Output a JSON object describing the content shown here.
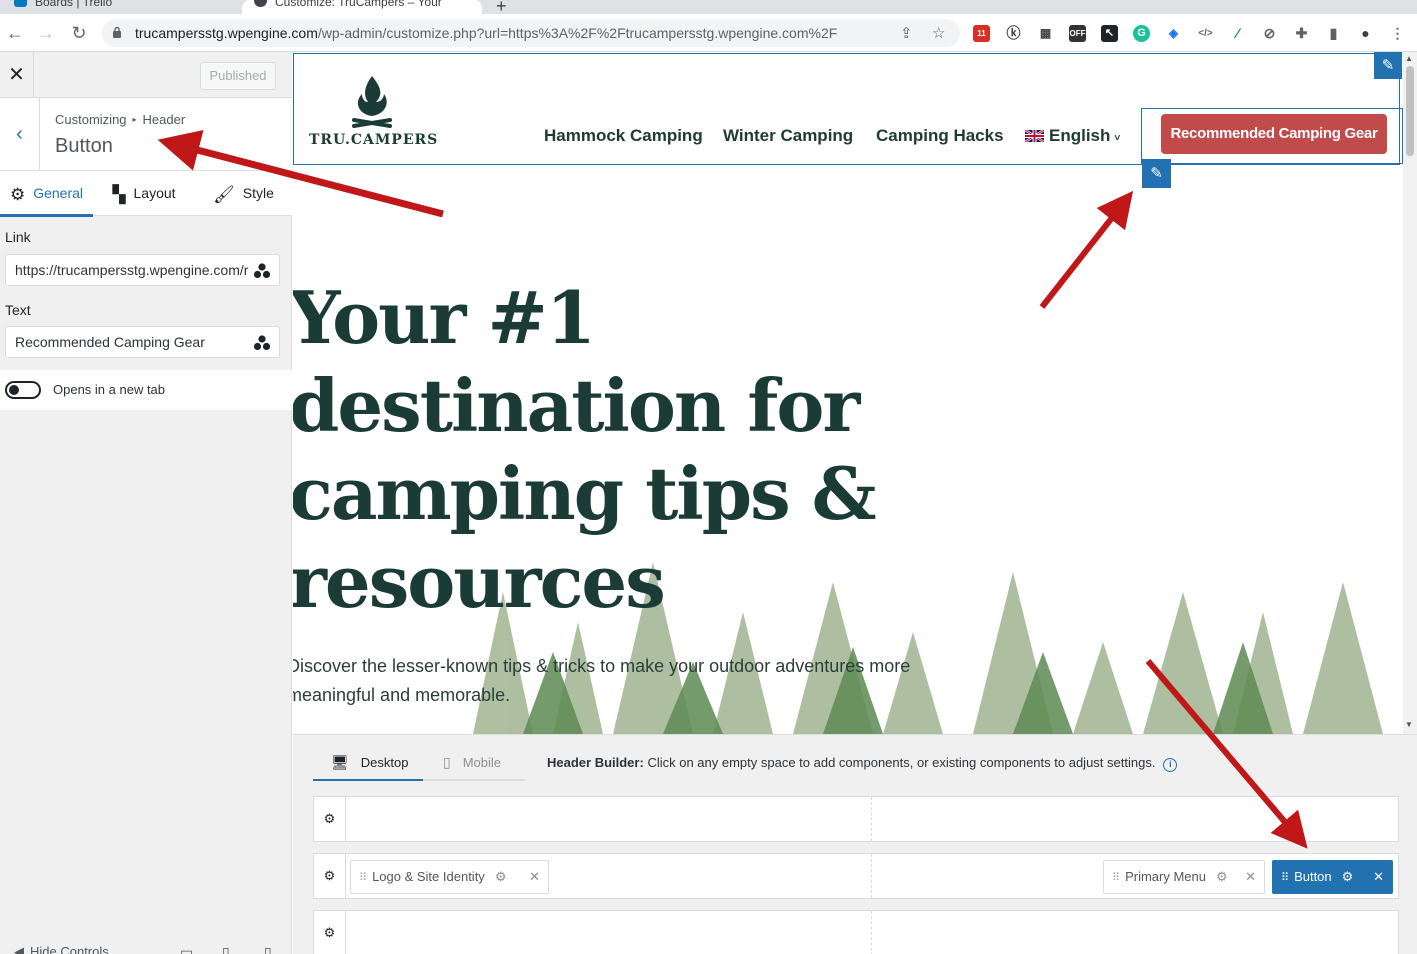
{
  "browser": {
    "tabs": [
      {
        "title": "Boards | Trello"
      },
      {
        "title": "Customize: TruCampers – Your"
      }
    ],
    "url_host": "trucampersstg.wpengine.com",
    "url_path": "/wp-admin/customize.php?url=https%3A%2F%2Ftrucampersstg.wpengine.com%2F",
    "calendar_badge": "11",
    "ext_off_label": "OFF"
  },
  "sidebar": {
    "published_label": "Published",
    "breadcrumb": {
      "root": "Customizing",
      "parent": "Header"
    },
    "section_title": "Button",
    "tabs": [
      {
        "label": "General",
        "active": true
      },
      {
        "label": "Layout",
        "active": false
      },
      {
        "label": "Style",
        "active": false
      }
    ],
    "link_label": "Link",
    "link_value": "https://trucampersstg.wpengine.com/r",
    "text_label": "Text",
    "text_value": "Recommended Camping Gear",
    "new_tab_label": "Opens in a new tab",
    "new_tab_enabled": false,
    "hide_controls_label": "Hide Controls"
  },
  "preview": {
    "logo_text": "TRU.CAMPERS",
    "menu": [
      "Hammock Camping",
      "Winter Camping",
      "Camping Hacks",
      "English"
    ],
    "cta_label": "Recommended Camping Gear",
    "cta_color": "#c14a4a",
    "hero_title": "Your #1 destination for camping tips & resources",
    "hero_subtitle": "Discover the lesser-known tips & tricks to make your outdoor adventures more meaningful and memorable."
  },
  "builder": {
    "device_tabs": [
      {
        "label": "Desktop",
        "active": true
      },
      {
        "label": "Mobile",
        "active": false
      }
    ],
    "note_bold": "Header Builder:",
    "note_text": "Click on any empty space to add components, or existing components to adjust settings.",
    "components": {
      "logo": "Logo & Site Identity",
      "menu": "Primary Menu",
      "button": "Button"
    }
  },
  "colors": {
    "accent": "#2271b1",
    "annotation_arrow": "#c01818",
    "brand_dark": "#1b3b36"
  }
}
